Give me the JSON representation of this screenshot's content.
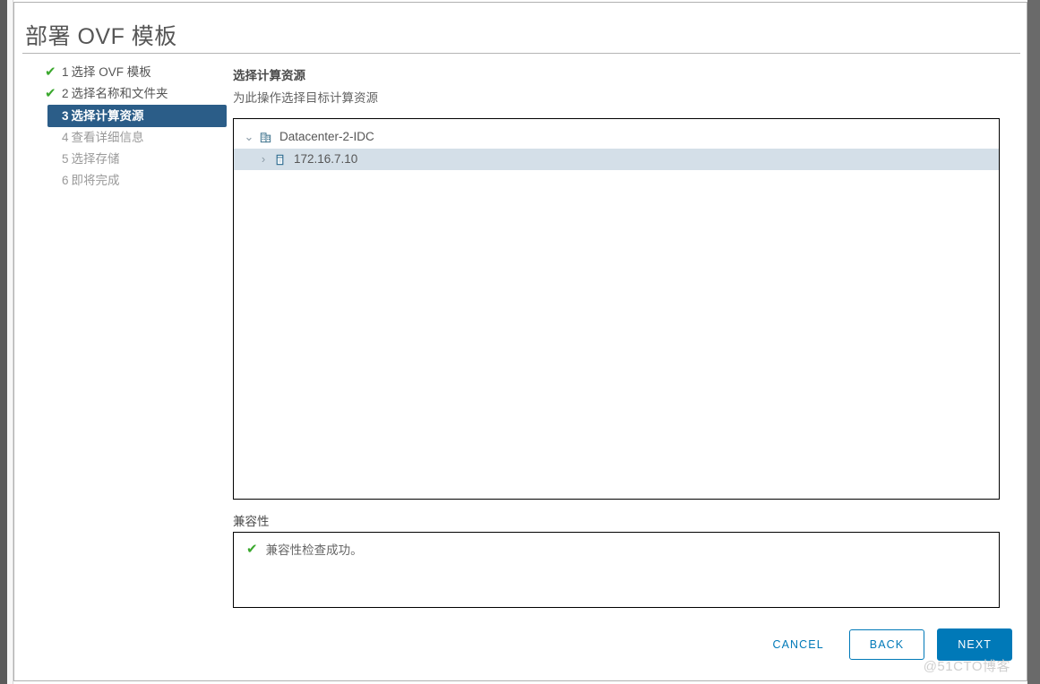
{
  "dialog": {
    "title": "部署 OVF 模板"
  },
  "steps": [
    {
      "num": "1",
      "label": "选择 OVF 模板",
      "state": "done",
      "check": "✔"
    },
    {
      "num": "2",
      "label": "选择名称和文件夹",
      "state": "done",
      "check": "✔"
    },
    {
      "num": "3",
      "label": "选择计算资源",
      "state": "current"
    },
    {
      "num": "4",
      "label": "查看详细信息",
      "state": "pending"
    },
    {
      "num": "5",
      "label": "选择存储",
      "state": "pending"
    },
    {
      "num": "6",
      "label": "即将完成",
      "state": "pending"
    }
  ],
  "content": {
    "heading": "选择计算资源",
    "subheading": "为此操作选择目标计算资源"
  },
  "tree": {
    "datacenter": {
      "label": "Datacenter-2-IDC",
      "chevron": "⌄",
      "icon": "datacenter-icon",
      "expanded": true
    },
    "host": {
      "label": "172.16.7.10",
      "chevron": "›",
      "icon": "host-icon",
      "expanded": false,
      "selected": true
    }
  },
  "compatibility": {
    "heading": "兼容性",
    "check": "✔",
    "message": "兼容性检查成功。"
  },
  "footer": {
    "cancel_label": "CANCEL",
    "back_label": "BACK",
    "next_label": "NEXT"
  },
  "watermark": "@51CTO博客",
  "colors": {
    "accent_blue": "#0079b8",
    "step_current_bg": "#2b5d88",
    "success_green": "#3aa82d",
    "selected_row_bg": "#d4dfe8"
  }
}
